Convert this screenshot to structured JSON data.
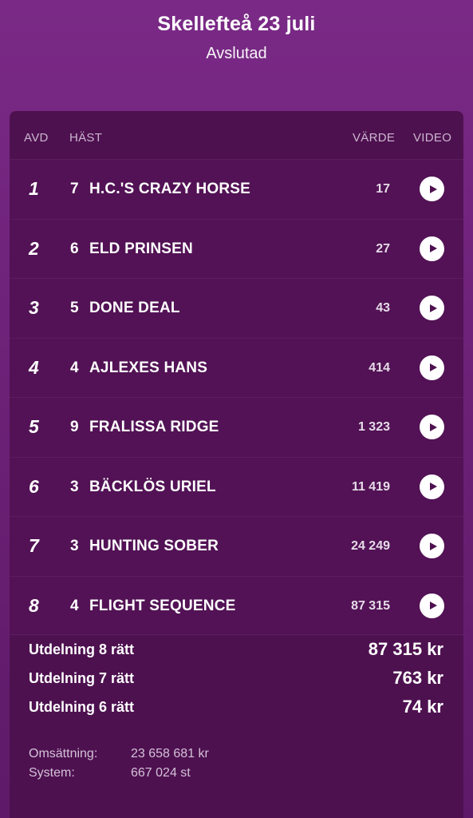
{
  "header": {
    "title": "Skellefteå 23 juli",
    "status": "Avslutad"
  },
  "table": {
    "columns": {
      "avd": "AVD",
      "hast": "HÄST",
      "varde": "VÄRDE",
      "video": "VIDEO"
    },
    "rows": [
      {
        "avd": "1",
        "num": "7",
        "name": "H.C.'S CRAZY HORSE",
        "value": "17"
      },
      {
        "avd": "2",
        "num": "6",
        "name": "ELD PRINSEN",
        "value": "27"
      },
      {
        "avd": "3",
        "num": "5",
        "name": "DONE DEAL",
        "value": "43"
      },
      {
        "avd": "4",
        "num": "4",
        "name": "AJLEXES HANS",
        "value": "414"
      },
      {
        "avd": "5",
        "num": "9",
        "name": "FRALISSA RIDGE",
        "value": "1 323"
      },
      {
        "avd": "6",
        "num": "3",
        "name": "BÄCKLÖS URIEL",
        "value": "11 419"
      },
      {
        "avd": "7",
        "num": "3",
        "name": "HUNTING SOBER",
        "value": "24 249"
      },
      {
        "avd": "8",
        "num": "4",
        "name": "FLIGHT SEQUENCE",
        "value": "87 315"
      }
    ]
  },
  "payouts": [
    {
      "label": "Utdelning 8 rätt",
      "value": "87 315 kr"
    },
    {
      "label": "Utdelning 7 rätt",
      "value": "763 kr"
    },
    {
      "label": "Utdelning 6 rätt",
      "value": "74 kr"
    }
  ],
  "stats": {
    "omsattning_label": "Omsättning:",
    "omsattning_value": "23 658 681 kr",
    "system_label": "System:",
    "system_value": "667 024 st"
  },
  "icons": {
    "play": "play-icon"
  },
  "colors": {
    "background_top": "#7a2a86",
    "card": "#4e1150",
    "play_button": "#ffffff"
  }
}
